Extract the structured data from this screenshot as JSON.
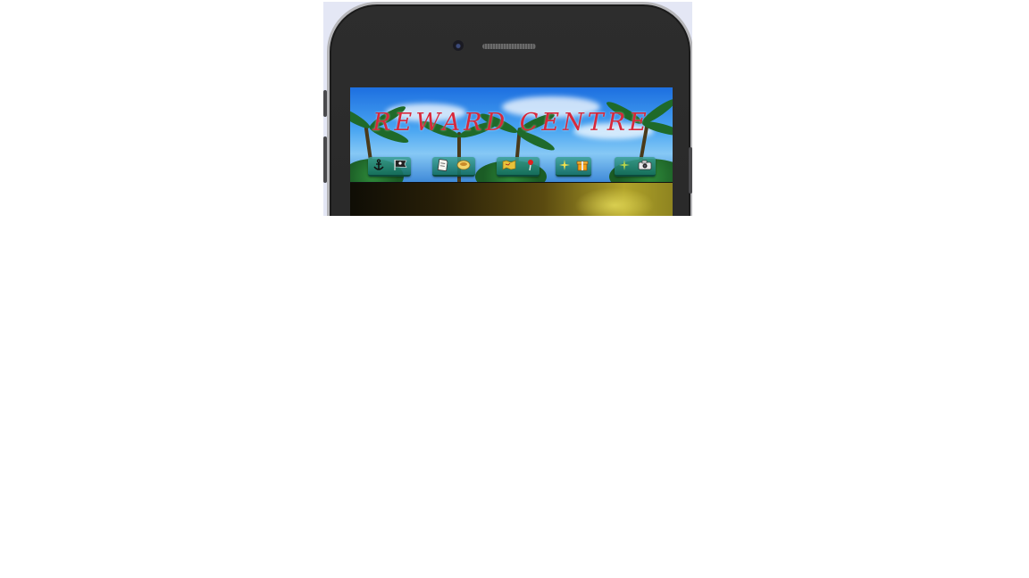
{
  "app": {
    "title": "REWARD CENTRE"
  },
  "nav": {
    "groups": [
      {
        "name": "home",
        "icons": [
          "anchor-icon",
          "pirate-flag-icon"
        ]
      },
      {
        "name": "notes",
        "icons": [
          "note-icon",
          "coin-bowl-icon"
        ]
      },
      {
        "name": "map",
        "icons": [
          "treasure-map-icon",
          "location-pin-icon"
        ]
      },
      {
        "name": "rewards",
        "icons": [
          "sparkle-icon",
          "gift-icon"
        ]
      },
      {
        "name": "photos",
        "icons": [
          "sparkle-icon",
          "camera-icon"
        ]
      }
    ]
  },
  "colors": {
    "title": "#d8283a",
    "nav_button": "#1f7a68",
    "phone_frame": "#262626",
    "viewport_bg": "#e4e7f5"
  }
}
